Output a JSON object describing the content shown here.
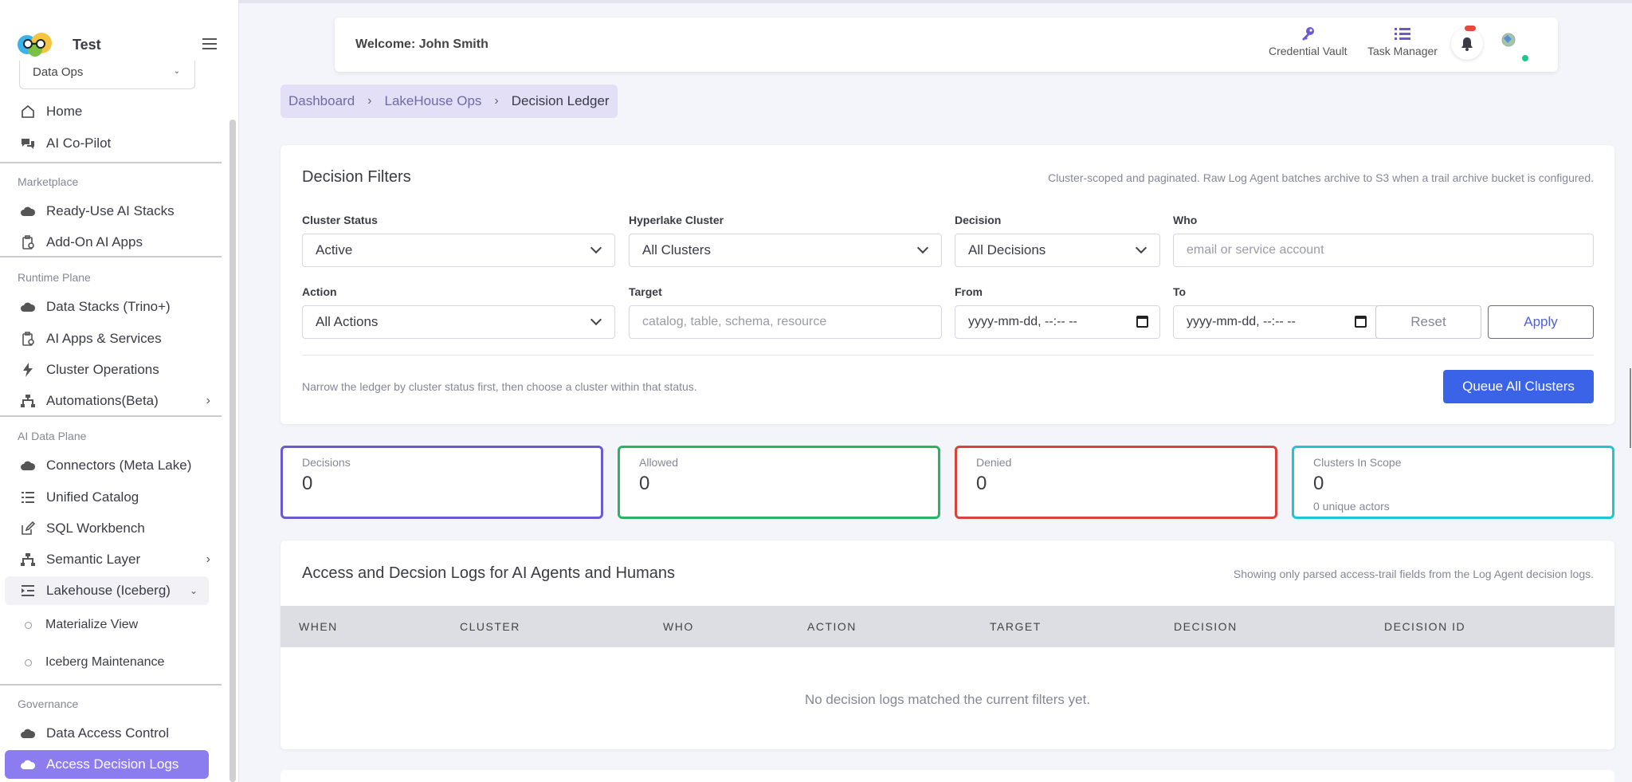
{
  "app": {
    "title": "Test",
    "org": "Data Ops"
  },
  "sidebar": {
    "top_items": [
      {
        "label": "Home",
        "icon": "home-icon"
      },
      {
        "label": "AI Co-Pilot",
        "icon": "chat-icon"
      }
    ],
    "sections": [
      {
        "title": "Marketplace",
        "items": [
          {
            "label": "Ready-Use AI Stacks",
            "icon": "cloud-icon"
          },
          {
            "label": "Add-On AI Apps",
            "icon": "clipboard-icon"
          }
        ]
      },
      {
        "title": "Runtime Plane",
        "items": [
          {
            "label": "Data Stacks (Trino+)",
            "icon": "cloud-icon"
          },
          {
            "label": "AI Apps & Services",
            "icon": "clipboard-icon"
          },
          {
            "label": "Cluster Operations",
            "icon": "bolt-icon"
          },
          {
            "label": "Automations(Beta)",
            "icon": "sitemap-icon"
          }
        ]
      },
      {
        "title": "AI Data Plane",
        "items": [
          {
            "label": "Connectors (Meta Lake)",
            "icon": "cloud-icon"
          },
          {
            "label": "Unified Catalog",
            "icon": "list-icon"
          },
          {
            "label": "SQL Workbench",
            "icon": "edit-icon"
          },
          {
            "label": "Semantic Layer",
            "icon": "sitemap-icon"
          },
          {
            "label": "Lakehouse (Iceberg)",
            "icon": "indent-icon"
          }
        ],
        "subitems": [
          "Materialize View",
          "Iceberg Maintenance"
        ]
      },
      {
        "title": "Governance",
        "items": [
          {
            "label": "Data Access Control",
            "icon": "cloud-icon"
          },
          {
            "label": "Access Decision Logs",
            "icon": "cloud-icon"
          }
        ]
      }
    ]
  },
  "topbar": {
    "welcome": "Welcome: John Smith",
    "credential_vault": "Credential Vault",
    "task_manager": "Task Manager"
  },
  "breadcrumb": [
    "Dashboard",
    "LakeHouse Ops",
    "Decision Ledger"
  ],
  "filters": {
    "title": "Decision Filters",
    "note": "Cluster-scoped and paginated. Raw Log Agent batches archive to S3 when a trail archive bucket is configured.",
    "cluster_status": {
      "label": "Cluster Status",
      "value": "Active"
    },
    "hyperlake_cluster": {
      "label": "Hyperlake Cluster",
      "value": "All Clusters"
    },
    "decision": {
      "label": "Decision",
      "value": "All Decisions"
    },
    "who": {
      "label": "Who",
      "placeholder": "email or service account"
    },
    "action": {
      "label": "Action",
      "value": "All Actions"
    },
    "target": {
      "label": "Target",
      "placeholder": "catalog, table, schema, resource"
    },
    "from": {
      "label": "From",
      "placeholder": "yyyy-mm-dd, --:-- --"
    },
    "to": {
      "label": "To",
      "placeholder": "yyyy-mm-dd, --:-- --"
    },
    "reset": "Reset",
    "apply": "Apply",
    "hint": "Narrow the ledger by cluster status first, then choose a cluster within that status.",
    "queue": "Queue All Clusters"
  },
  "stats": [
    {
      "label": "Decisions",
      "value": "0",
      "color": "#6a5acd"
    },
    {
      "label": "Allowed",
      "value": "0",
      "color": "#28b463"
    },
    {
      "label": "Denied",
      "value": "0",
      "color": "#d9433a"
    },
    {
      "label": "Clusters In Scope",
      "value": "0",
      "sub": "0 unique actors",
      "color": "#22c3d4"
    }
  ],
  "logs": {
    "title": "Access and Decsion Logs for AI Agents and Humans",
    "note": "Showing only parsed access-trail fields from the Log Agent decision logs.",
    "columns": [
      "WHEN",
      "CLUSTER",
      "WHO",
      "ACTION",
      "TARGET",
      "DECISION",
      "DECISION ID"
    ],
    "empty": "No decision logs matched the current filters yet."
  }
}
